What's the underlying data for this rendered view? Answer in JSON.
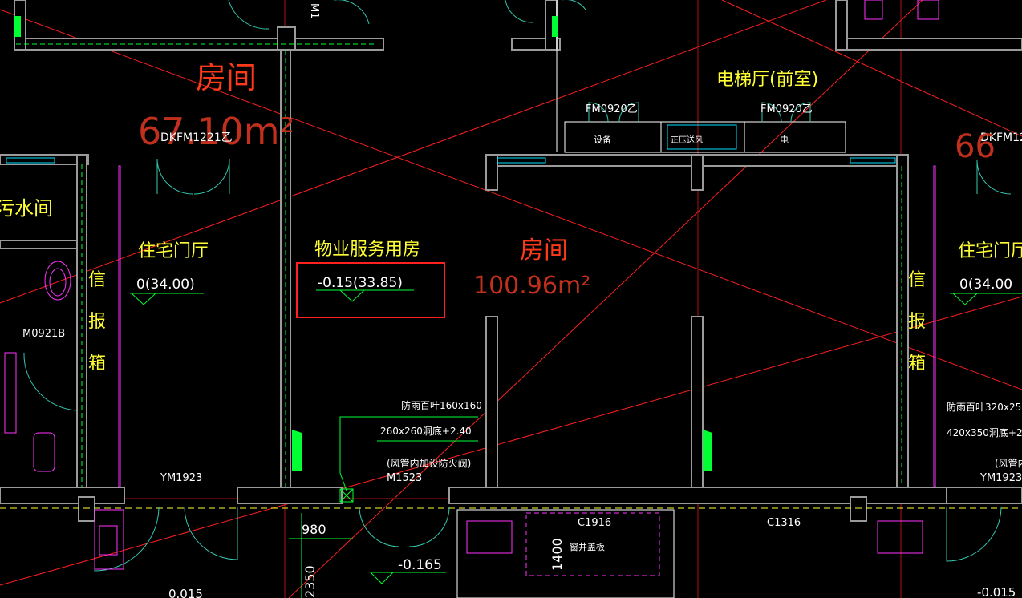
{
  "colors": {
    "background": "#000000",
    "wall": "#8c8c8c",
    "wall_fill": "#9a9a9a",
    "axis_red": "#ff2020",
    "room_label_red": "#ff3a1a",
    "room_area_red": "#c0301c",
    "yellow_text": "#ffff33",
    "white_text": "#ffffff",
    "cyan": "#00e0ff",
    "green": "#00ff33",
    "magenta": "#ff33ff",
    "highlight_box": "#ff2020"
  },
  "labels": {
    "room_top_left": "房间",
    "room_top_left_area": "67.10m²",
    "door_top_left": "DKFM1221乙",
    "elevator_hall": "电梯厅(前室)",
    "fm_door_1": "FM0920乙",
    "fm_door_2": "FM0920乙",
    "shaft_1": "设备",
    "shaft_2": "正压送风",
    "shaft_3": "电",
    "door_right_top": "DKFM12",
    "room_right_top_area": "66",
    "wc": "污水间",
    "lobby_left": "住宅门厅",
    "lobby_left_level": "0(34.00)",
    "mailbox_left_1": "信",
    "mailbox_left_2": "报",
    "mailbox_left_3": "箱",
    "door_m0921b": "M0921B",
    "door_ym1923_left": "YM1923",
    "property_room": "物业服务用房",
    "property_level": "-0.15(33.85)",
    "room_center": "房间",
    "room_center_area": "100.96m²",
    "mailbox_right_1": "信",
    "mailbox_right_2": "报",
    "mailbox_right_3": "箱",
    "lobby_right": "住宅门厅",
    "lobby_right_level": "0(34.00",
    "louver_note_1": "防雨百叶160x160",
    "louver_note_2": "260x260洞底+2.40",
    "damper_note": "(风管内加设防火阀)",
    "door_m1523": "M1523",
    "louver_right_1": "防雨百叶320x250",
    "louver_right_2": "420x350洞底+2.",
    "damper_right": "(风管内",
    "door_ym1923_right": "YM1923",
    "window_c1916": "C1916",
    "window_c1316": "C1316",
    "well_cover": "窗井盖板",
    "dim_980": "980",
    "dim_1400": "1400",
    "dim_2350": "2350",
    "level_bottom": "-0.165",
    "level_bottom_left": "0.015",
    "level_bottom_right": "-0.015",
    "top_fragment_m1": "M1"
  }
}
